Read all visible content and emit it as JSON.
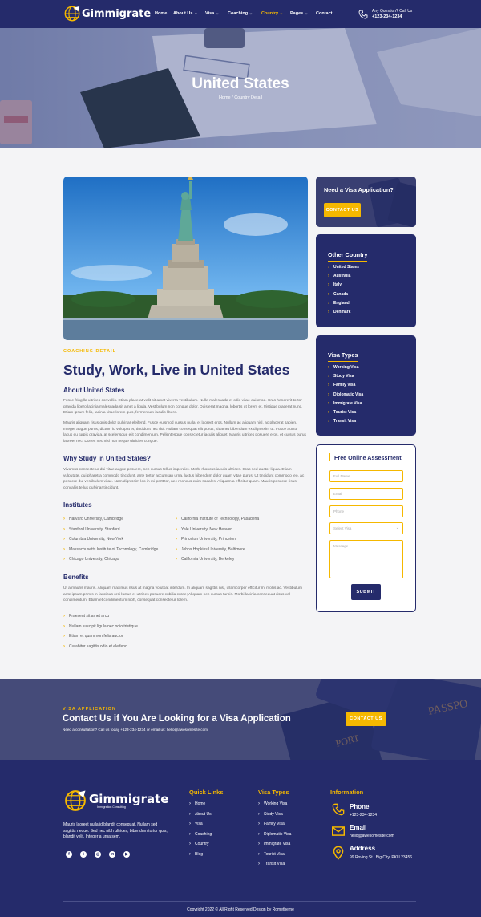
{
  "header": {
    "logo_text": "Gimmigrate",
    "nav": [
      {
        "label": "Home",
        "dropdown": false,
        "active": false
      },
      {
        "label": "About Us",
        "dropdown": true,
        "active": false
      },
      {
        "label": "Visa",
        "dropdown": true,
        "active": false
      },
      {
        "label": "Coaching",
        "dropdown": true,
        "active": false
      },
      {
        "label": "Country",
        "dropdown": true,
        "active": true
      },
      {
        "label": "Pages",
        "dropdown": true,
        "active": false
      },
      {
        "label": "Contact",
        "dropdown": false,
        "active": false
      }
    ],
    "question_label": "Any Question? Call Us",
    "phone": "+123-234-1234"
  },
  "hero": {
    "title": "United States",
    "breadcrumb": "Home / Country Detail"
  },
  "main": {
    "tagline": "COACHING DETAIL",
    "title": "Study, Work, Live in United States",
    "about_heading": "About United States",
    "about_p1": "Fusce fringilla ultrices convallis. Etiam placerat velit sit amet viverra vestibulum. Nulla malesuada et odio vitae euismod. Cras hendrerit tortor gravida libero lacinia malesuada sit amet a ligula. Vestibulum non congue dolor. Duis erat magna, lobortis ut lorem et, tristique placerat nunc. Etiam ipsum felis, lacinia vitae lorem quis, fermentum iaculis libero.",
    "about_p2": "Mauris aliquam risus quis dolor pulvinar eleifend. Fusce euismod cursus nulla, et laoreet eros. Nullam ac aliquam nisl, ac placerat sapien. Integer augue purus, dictum id volutpat et, tincidunt nec dui. Nullam consequat elit purus, sit amet bibendum ex dignissim ut. Fusce auctor lacus eu turpis gravida, at scelerisque elit condimentum. Pellentesque consectetur iaculis aliquet. Mauris ultrices posuere eros, et cursus purus laoreet nec. Donec nec nisl non neque ultricies congue.",
    "why_heading": "Why Study in United States?",
    "why_p": "Vivamus consectetur dui vitae augue posuere, nec cursus tellus imperdiet. Morbi rhoncus iaculis ultrices. Cras sed auctor ligula. Etiam vulputate, dui pharetra commodo tincidunt, ante tortor accumsan urna, luctus bibendum dolor quam vitae purus. Ut tincidunt commodo leo, ac posuere dui vestibulum vitae. Nam dignissim leo in mi porttitor, nec rhoncus enim sodales. Aliquam a efficitur quam. Mauris posuere risus convallis tellus pulvinar tincidunt.",
    "institutes_heading": "Institutes",
    "institutes_left": [
      "Harvard University, Cambridge",
      "Stanford University, Stanford",
      "Columbia University, New York",
      "Massachusetts Institute of Technology, Cambridge",
      "Chicago University, Chicago"
    ],
    "institutes_right": [
      "California Institute of Technology, Pasadena",
      "Yale University, New Heaven",
      "Princeton University, Princeton",
      "Johns Hopkins University, Baltimore",
      "California University, Berkeley"
    ],
    "benefits_heading": "Benefits",
    "benefits_p": "Ut a mauris mauris. Aliquam maximus risus at magna volutpat interdum. In aliquam sagittis nisl, ullamcorper efficitur mi mollis ac. Vestibulum ante ipsum primis in faucibus orci luctus et ultrices posuere cubilia curae; Aliquam nec cursus turpis. Morbi lacinia consequat risus vel condimentum. Etiam et condimentum nibh, consequat consectetur lorem.",
    "benefits": [
      "Praesent sit amet arcu",
      "Nullam suscipit ligula nec odio tristique",
      "Etiam et quam non felis auctor",
      "Curabitur sagittis odio et eleifend"
    ]
  },
  "sidebar": {
    "visa_box_title": "Need a Visa Application?",
    "visa_box_button": "CONTACT US",
    "other_country_title": "Other Country",
    "countries": [
      "United States",
      "Australia",
      "Italy",
      "Canada",
      "England",
      "Denmark"
    ],
    "visa_types_title": "Visa Types",
    "visa_types": [
      "Working Visa",
      "Study Visa",
      "Family Visa",
      "Diplomatic Visa",
      "Immigrate Visa",
      "Tourist Visa",
      "Transit Visa"
    ],
    "form_title": "Free Online Assessment",
    "form_full_name": "Full Name",
    "form_email": "Email",
    "form_phone": "Phone",
    "form_select": "Select Visa",
    "form_message": "Message",
    "form_submit": "SUBMIT"
  },
  "cta": {
    "tagline": "VISA APPLICATION",
    "title": "Contact Us if You Are Looking for a Visa Application",
    "text": "Need a consultation? Call us today +123-234-1234 or email us: hello@awesomesite.com",
    "button": "CONTACT US"
  },
  "footer": {
    "logo_text": "Gimmigrate",
    "logo_sub": "Immigration Consulting",
    "about": "Mauris laoreet nulla id blandit consequat. Nullam sed sagittis neque. Sed nec nibh ultrices, bibendum tortor quis, blandit velit. Integer a urna sem.",
    "social_icons": [
      "facebook-icon",
      "twitter-icon",
      "instagram-icon",
      "linkedin-icon",
      "youtube-icon"
    ],
    "quick_links_title": "Quick Links",
    "quick_links": [
      "Home",
      "About Us",
      "Visa",
      "Coaching",
      "Country",
      "Blog"
    ],
    "visa_types_title": "Visa Types",
    "visa_types": [
      "Working Visa",
      "Study Visa",
      "Family Visa",
      "Diplomatic Visa",
      "Immigrate Visa",
      "Tourist Visa",
      "Transit Visa"
    ],
    "info_title": "Information",
    "phone_label": "Phone",
    "phone": "+123-234-1234",
    "email_label": "Email",
    "email": "hello@awesomesite.com",
    "address_label": "Address",
    "address": "99 Roving St., Big City, PKU 23456",
    "copyright": "Copyright 2022 © All Right Reserved Design by Rometheme"
  },
  "colors": {
    "navy": "#252b6b",
    "accent": "#f5b800",
    "background": "#f4f4f6"
  }
}
